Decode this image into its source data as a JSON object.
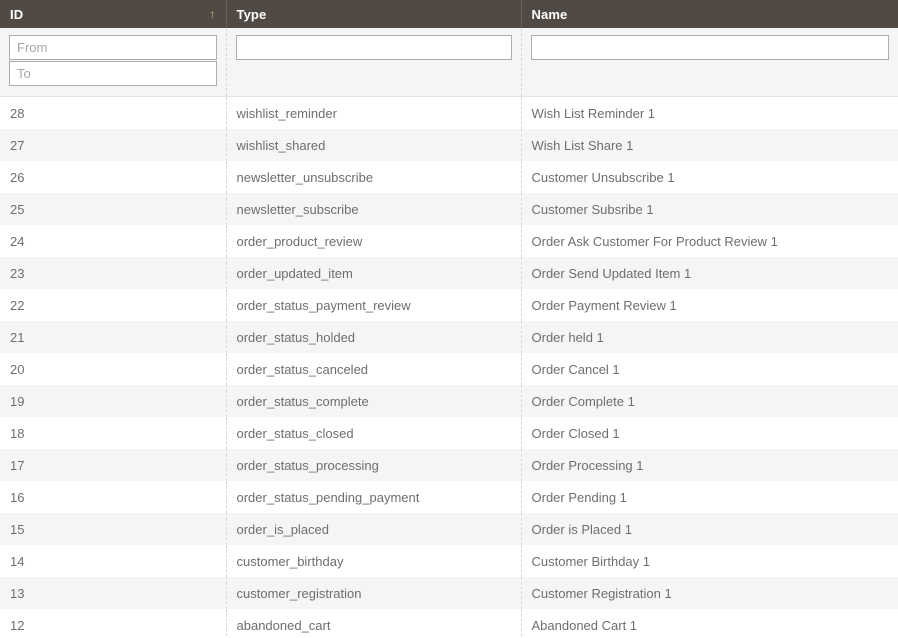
{
  "grid": {
    "columns": [
      {
        "key": "id",
        "label": "ID",
        "sorted": true,
        "sort_direction": "asc",
        "sort_icon": "arrow-up-icon"
      },
      {
        "key": "type",
        "label": "Type",
        "sorted": false,
        "sort_direction": "",
        "sort_icon": ""
      },
      {
        "key": "name",
        "label": "Name",
        "sorted": false,
        "sort_direction": "",
        "sort_icon": ""
      }
    ],
    "filters": {
      "id_from": {
        "value": "",
        "placeholder": "From"
      },
      "id_to": {
        "value": "",
        "placeholder": "To"
      },
      "type": {
        "value": "",
        "placeholder": ""
      },
      "name": {
        "value": "",
        "placeholder": ""
      }
    },
    "rows": [
      {
        "id": "28",
        "type": "wishlist_reminder",
        "name": "Wish List Reminder 1"
      },
      {
        "id": "27",
        "type": "wishlist_shared",
        "name": "Wish List Share 1"
      },
      {
        "id": "26",
        "type": "newsletter_unsubscribe",
        "name": "Customer Unsubscribe 1"
      },
      {
        "id": "25",
        "type": "newsletter_subscribe",
        "name": "Customer Subsribe 1"
      },
      {
        "id": "24",
        "type": "order_product_review",
        "name": "Order Ask Customer For Product Review 1"
      },
      {
        "id": "23",
        "type": "order_updated_item",
        "name": "Order Send Updated Item 1"
      },
      {
        "id": "22",
        "type": "order_status_payment_review",
        "name": "Order Payment Review 1"
      },
      {
        "id": "21",
        "type": "order_status_holded",
        "name": "Order held 1"
      },
      {
        "id": "20",
        "type": "order_status_canceled",
        "name": "Order Cancel 1"
      },
      {
        "id": "19",
        "type": "order_status_complete",
        "name": "Order Complete 1"
      },
      {
        "id": "18",
        "type": "order_status_closed",
        "name": "Order Closed 1"
      },
      {
        "id": "17",
        "type": "order_status_processing",
        "name": "Order Processing 1"
      },
      {
        "id": "16",
        "type": "order_status_pending_payment",
        "name": "Order Pending 1"
      },
      {
        "id": "15",
        "type": "order_is_placed",
        "name": "Order is Placed 1"
      },
      {
        "id": "14",
        "type": "customer_birthday",
        "name": "Customer Birthday 1"
      },
      {
        "id": "13",
        "type": "customer_registration",
        "name": "Customer Registration 1"
      },
      {
        "id": "12",
        "type": "abandoned_cart",
        "name": "Abandoned Cart 1"
      }
    ]
  },
  "colors": {
    "header_background": "#514943",
    "header_text": "#ffffff",
    "sort_arrow": "#d4b28b",
    "row_odd": "#ffffff",
    "row_even": "#f5f5f5",
    "filter_background": "#f5f5f5",
    "body_text": "#6e6e6e"
  }
}
